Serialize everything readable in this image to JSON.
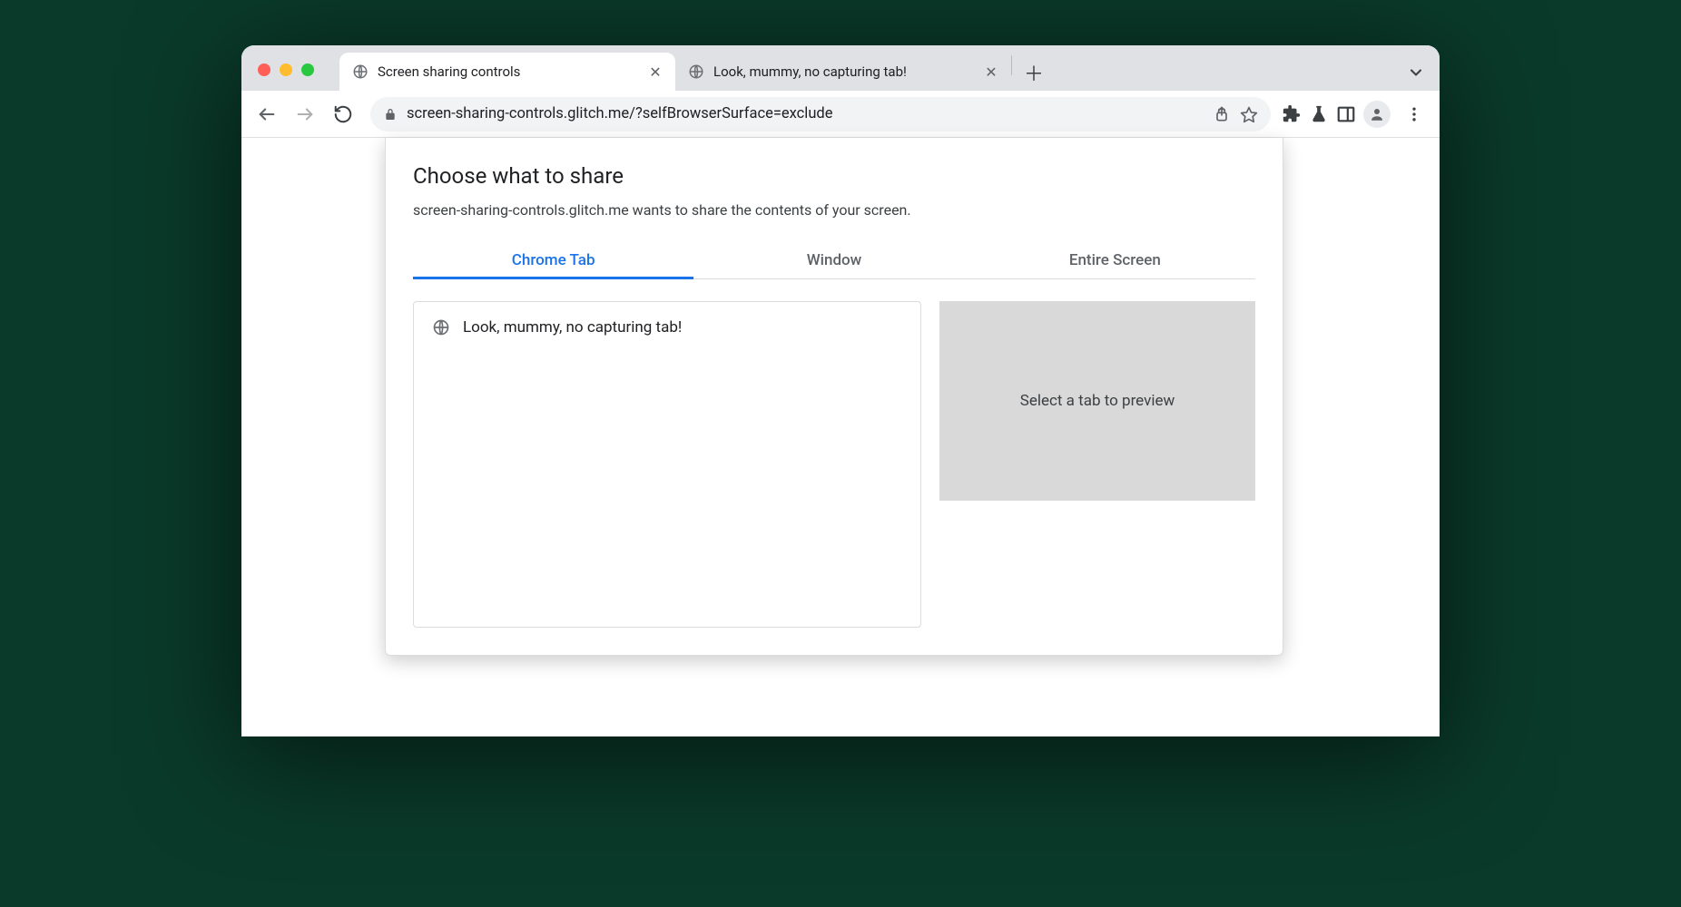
{
  "browser": {
    "tabs": [
      {
        "title": "Screen sharing controls",
        "active": true
      },
      {
        "title": "Look, mummy, no capturing tab!",
        "active": false
      }
    ],
    "url": "screen-sharing-controls.glitch.me/?selfBrowserSurface=exclude"
  },
  "dialog": {
    "title": "Choose what to share",
    "subtitle": "screen-sharing-controls.glitch.me wants to share the contents of your screen.",
    "tabs": {
      "chrome_tab": "Chrome Tab",
      "window": "Window",
      "entire_screen": "Entire Screen"
    },
    "sources": [
      {
        "label": "Look, mummy, no capturing tab!"
      }
    ],
    "preview_placeholder": "Select a tab to preview"
  }
}
